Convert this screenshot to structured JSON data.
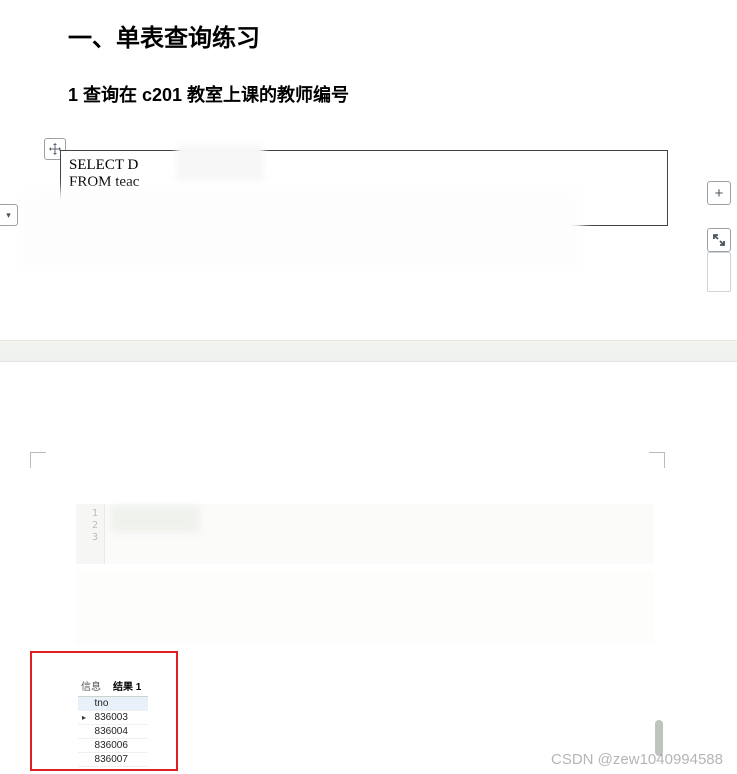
{
  "doc": {
    "heading": "一、单表查询练习",
    "subheading_prefix": "1",
    "subheading_text": " 查询在 c201 教室上课的教师编号",
    "sql": {
      "line1_part1": "SELECT D",
      "line1_part2_redmark": "o",
      "line2": "FROM teac"
    }
  },
  "editor": {
    "line_numbers": [
      "1",
      "2",
      "3"
    ]
  },
  "result": {
    "tabs": {
      "info": "信息",
      "result": "结果 1"
    },
    "header": "tno",
    "rows": [
      "836003",
      "836004",
      "836006",
      "836007"
    ]
  },
  "controls": {
    "plus": "+"
  },
  "watermark": "CSDN @zew1040994588"
}
